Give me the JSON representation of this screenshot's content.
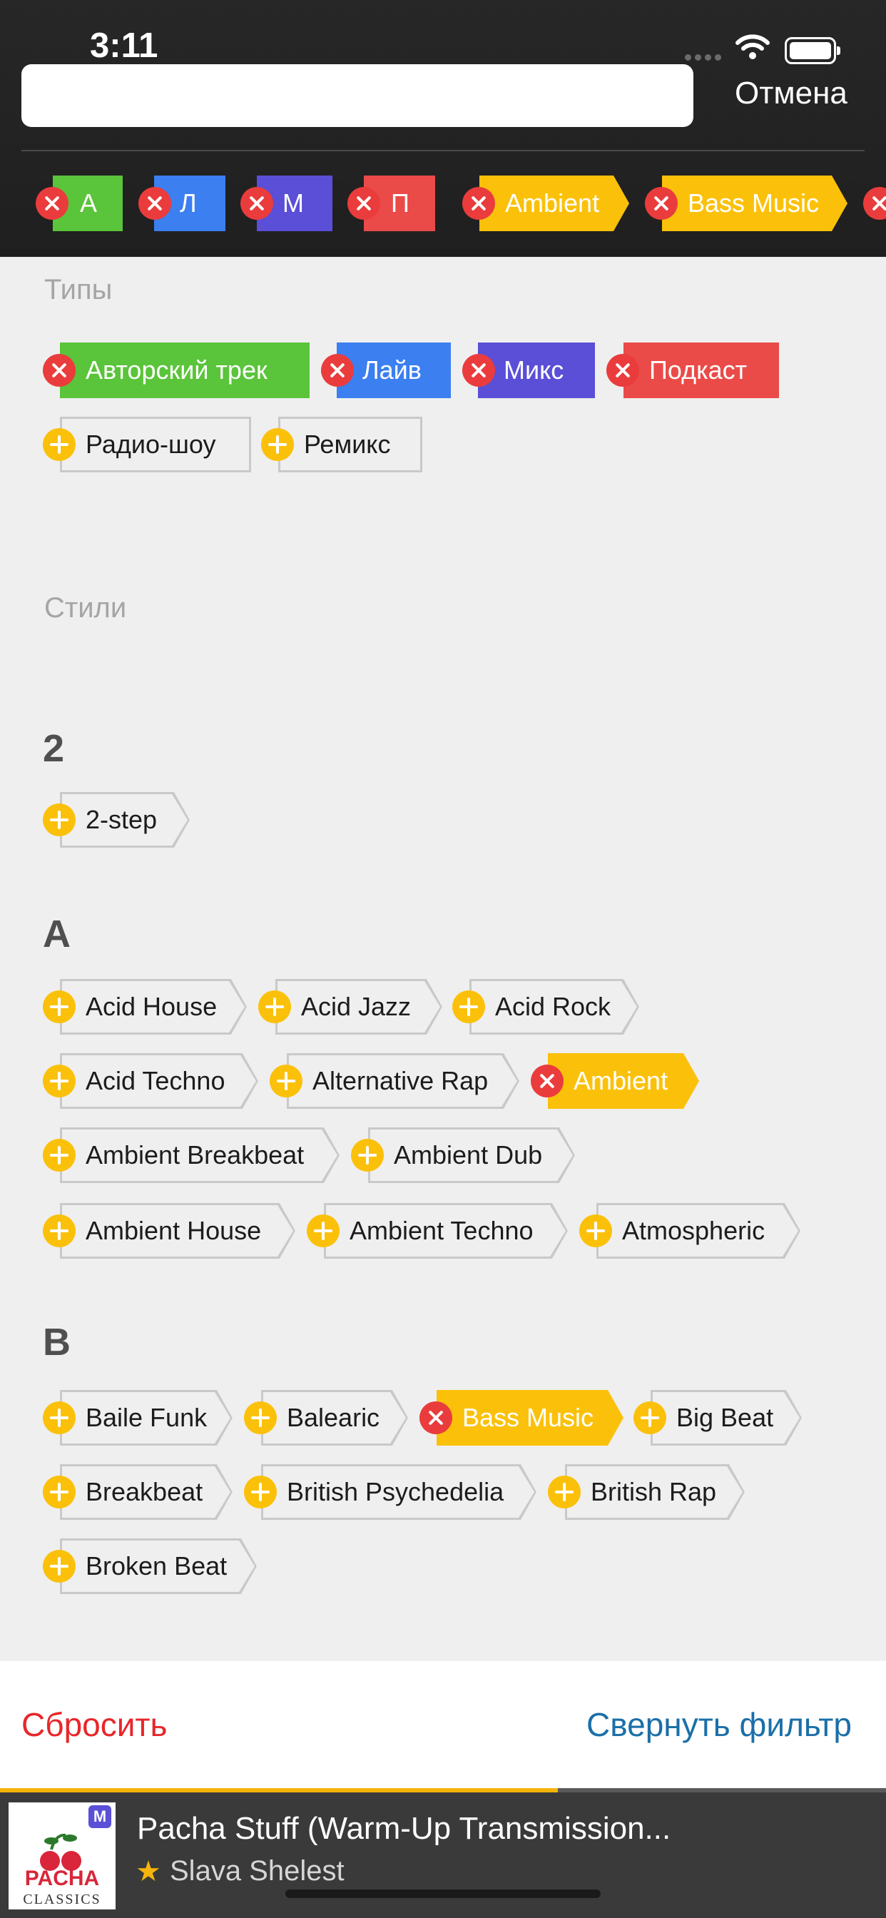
{
  "status_bar": {
    "time": "3:11"
  },
  "search": {
    "placeholder": "",
    "value": "",
    "cancel_label": "Отмена"
  },
  "selected_chips": [
    {
      "label": "А",
      "color": "#5ac43a"
    },
    {
      "label": "Л",
      "color": "#3b7ff0"
    },
    {
      "label": "М",
      "color": "#5a4fd6"
    },
    {
      "label": "П",
      "color": "#ea4b48"
    },
    {
      "label": "Ambient",
      "color": "#fbc10a"
    },
    {
      "label": "Bass Music",
      "color": "#fbc10a"
    }
  ],
  "types": {
    "title": "Типы",
    "selected": [
      {
        "label": "Авторский трек",
        "color": "#5ac43a"
      },
      {
        "label": "Лайв",
        "color": "#3b7ff0"
      },
      {
        "label": "Микс",
        "color": "#5a4fd6"
      },
      {
        "label": "Подкаст",
        "color": "#ea4b48"
      }
    ],
    "unselected": [
      "Радио-шоу",
      "Ремикс"
    ]
  },
  "styles": {
    "title": "Стили",
    "groups": [
      {
        "letter": "2",
        "items": [
          "2-step"
        ]
      },
      {
        "letter": "A",
        "items": [
          "Acid House",
          "Acid Jazz",
          "Acid Rock",
          "Acid Techno",
          "Alternative Rap",
          "Ambient",
          "Ambient Breakbeat",
          "Ambient Dub",
          "Ambient House",
          "Ambient Techno",
          "Atmospheric"
        ]
      },
      {
        "letter": "B",
        "items": [
          "Baile Funk",
          "Balearic",
          "Bass Music",
          "Big Beat",
          "Breakbeat",
          "British Psychedelia",
          "British Rap",
          "Broken Beat"
        ]
      }
    ],
    "selected_items": [
      "Ambient",
      "Bass Music"
    ],
    "selected_color": "#fbc10a"
  },
  "footer": {
    "reset_label": "Сбросить",
    "collapse_label": "Свернуть фильтр"
  },
  "player": {
    "title": "Pacha Stuff (Warm-Up Transmission...",
    "artist": "Slava Shelest",
    "badge": "M",
    "cover_text": "PACHA",
    "cover_subtext": "CLASSICS",
    "progress": 0.63,
    "accent": "#f6b40a"
  },
  "colors": {
    "remove": "#ea3c3c",
    "add": "#fbc10a",
    "header_bg": "#222222",
    "page_bg": "#efefef"
  }
}
